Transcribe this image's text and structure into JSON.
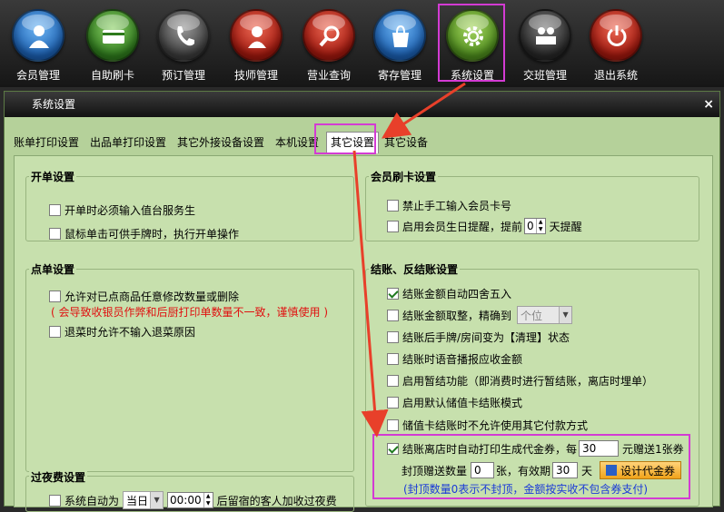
{
  "toolbar": {
    "items": [
      {
        "label": "会员管理",
        "icon": "member-icon",
        "color": "blue"
      },
      {
        "label": "自助刷卡",
        "icon": "card-icon",
        "color": "green"
      },
      {
        "label": "预订管理",
        "icon": "phone-icon",
        "color": "gray"
      },
      {
        "label": "技师管理",
        "icon": "technician-icon",
        "color": "red"
      },
      {
        "label": "营业查询",
        "icon": "search-icon",
        "color": "red"
      },
      {
        "label": "寄存管理",
        "icon": "bag-icon",
        "color": "blue"
      },
      {
        "label": "系统设置",
        "icon": "gear-icon",
        "color": "lgreen"
      },
      {
        "label": "交班管理",
        "icon": "handover-icon",
        "color": "dgray"
      },
      {
        "label": "退出系统",
        "icon": "power-icon",
        "color": "red"
      }
    ]
  },
  "dialog": {
    "title": "系统设置",
    "close": "×",
    "tabs": [
      "账单打印设置",
      "出品单打印设置",
      "其它外接设备设置",
      "本机设置",
      "其它设置",
      "其它设备"
    ],
    "active_tab": "其它设置"
  },
  "open_bill": {
    "title": "开单设置",
    "items": [
      {
        "label": "开单时必须输入值台服务生",
        "checked": false
      },
      {
        "label": "鼠标单击可供手牌时，执行开单操作",
        "checked": false
      }
    ]
  },
  "member_card": {
    "title": "会员刷卡设置",
    "disable_manual": {
      "label": "禁止手工输入会员卡号",
      "checked": false
    },
    "birthday": {
      "label_before": "启用会员生日提醒，提前",
      "value": "0",
      "label_after": "天提醒",
      "checked": false
    }
  },
  "order": {
    "title": "点单设置",
    "allow_modify": {
      "label": "允许对已点商品任意修改数量或删除",
      "checked": false
    },
    "warning": "( 会导致收银员作弊和后厨打印单数量不一致，谨慎使用 )",
    "refund_reason": {
      "label": "退菜时允许不输入退菜原因",
      "checked": false
    }
  },
  "checkout": {
    "title": "结账、反结账设置",
    "items": [
      {
        "label": "结账金额自动四舍五入",
        "checked": true
      },
      {
        "label": "结账金额取整，精确到",
        "checked": false,
        "select": "个位"
      },
      {
        "label": "结账后手牌/房间变为【清理】状态",
        "checked": false
      },
      {
        "label": "结账时语音播报应收金额",
        "checked": false
      },
      {
        "label": "启用暂结功能（即消费时进行暂结账，离店时埋单）",
        "checked": false
      },
      {
        "label": "启用默认储值卡结账模式",
        "checked": false
      },
      {
        "label": "储值卡结账时不允许使用其它付款方式",
        "checked": false
      }
    ],
    "coupon": {
      "checked": true,
      "label_before": "结账离店时自动打印生成代金券，每",
      "every_value": "30",
      "label_after": "元赠送1张券",
      "cap_label": "封顶赠送数量",
      "cap_value": "0",
      "validity_label": "张，有效期",
      "validity_value": "30",
      "days_label": "天",
      "design_button": "设计代金券",
      "note": "(封顶数量0表示不封顶，金额按实收不包含券支付)"
    }
  },
  "overnight": {
    "title": "过夜费设置",
    "auto_label": "系统自动为",
    "day_value": "当日",
    "time_value": "00:00",
    "after_label": "后留宿的客人加收过夜费",
    "checked": false
  },
  "colors": {
    "highlight": "#d33bd3",
    "arrow": "#e8402a",
    "panel": "#c7e0ad",
    "warning": "#e01010",
    "note": "#1a3ad8"
  }
}
